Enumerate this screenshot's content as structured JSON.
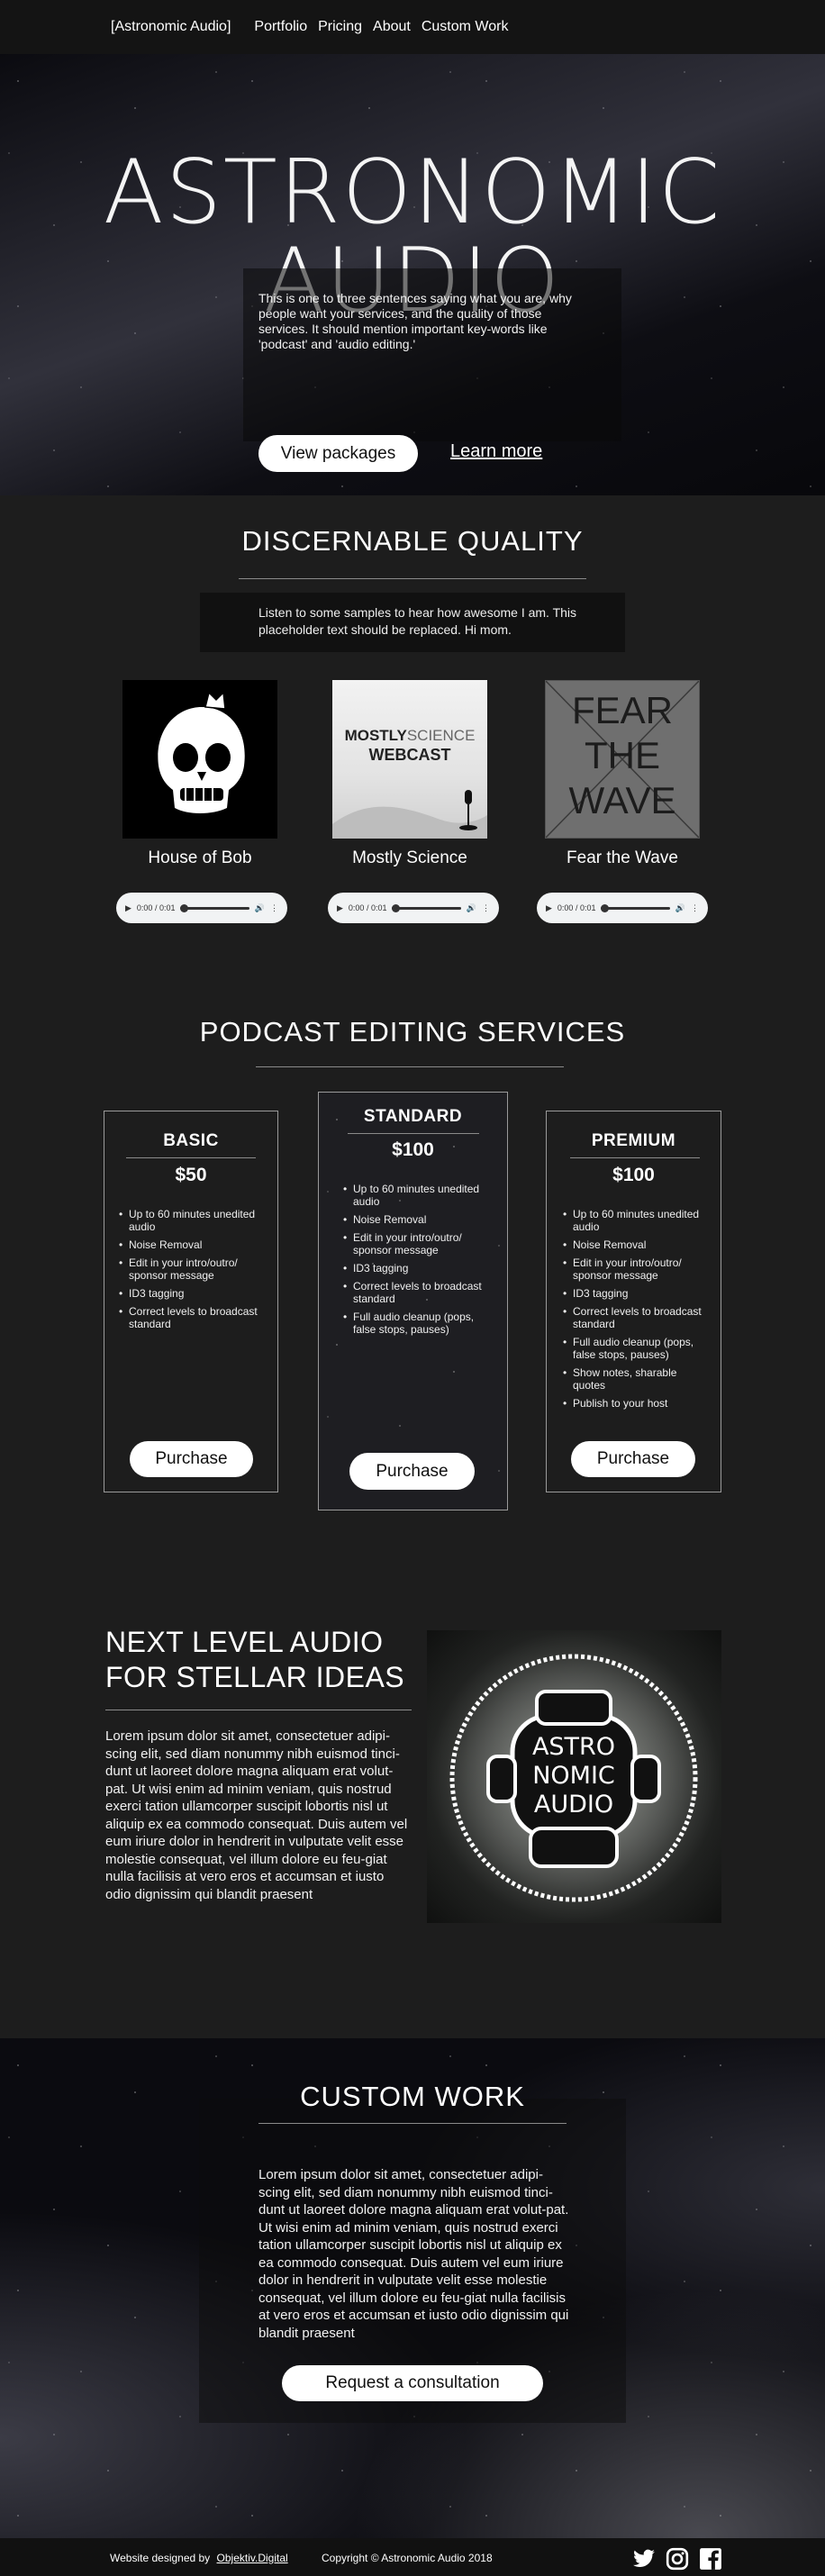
{
  "nav": {
    "brand": "[Astronomic Audio]",
    "items": [
      "Portfolio",
      "Pricing",
      "About",
      "Custom Work"
    ]
  },
  "hero": {
    "title": "ASTRONOMIC AUDIO",
    "text": "This is one to three sentences saying what you are, why people want your services, and the quality of those services. It should mention important key-words like 'podcast' and 'audio editing.'",
    "primary_button": "View packages",
    "secondary_link": "Learn more"
  },
  "quality": {
    "heading": "DISCERNABLE QUALITY",
    "text": "Listen to some samples to hear how awesome I am. This placeholder text should be replaced. Hi mom.",
    "samples": [
      {
        "label": "House of Bob",
        "time": "0:00 / 0:01"
      },
      {
        "label": "Mostly Science",
        "time": "0:00 / 0:01",
        "art_line1_a": "MOSTLY",
        "art_line1_b": "SCIENCE",
        "art_line2": "WEBCAST"
      },
      {
        "label": "Fear the Wave",
        "time": "0:00 / 0:01",
        "art_lines": [
          "FEAR",
          "THE",
          "WAVE"
        ]
      }
    ]
  },
  "services": {
    "heading": "PODCAST EDITING SERVICES",
    "plans": [
      {
        "name": "BASIC",
        "price": "$50",
        "features": [
          "Up to 60 minutes unedited audio",
          "Noise Removal",
          "Edit in your intro/outro/ sponsor message",
          "ID3 tagging",
          "Correct levels to broadcast standard"
        ],
        "button": "Purchase"
      },
      {
        "name": "STANDARD",
        "price": "$100",
        "features": [
          "Up to 60 minutes unedited audio",
          "Noise Removal",
          "Edit in your intro/outro/ sponsor message",
          "ID3 tagging",
          "Correct levels to broadcast standard",
          "Full audio cleanup (pops, false stops, pauses)"
        ],
        "button": "Purchase"
      },
      {
        "name": "PREMIUM",
        "price": "$100",
        "features": [
          "Up to 60 minutes unedited audio",
          "Noise Removal",
          "Edit in your intro/outro/ sponsor message",
          "ID3 tagging",
          "Correct levels to broadcast standard",
          "Full audio cleanup (pops, false stops, pauses)",
          "Show notes, sharable quotes",
          "Publish to your host"
        ],
        "button": "Purchase"
      }
    ]
  },
  "about": {
    "heading_line1": "NEXT LEVEL AUDIO",
    "heading_line2": "FOR STELLAR IDEAS",
    "text": "Lorem ipsum dolor sit amet, consectetuer adipi-scing elit, sed diam nonummy nibh euismod tinci-dunt ut laoreet dolore magna aliquam erat volut-pat. Ut wisi enim ad minim veniam, quis nostrud exerci tation ullamcorper suscipit lobortis nisl ut aliquip ex ea commodo consequat. Duis autem vel eum iriure dolor in hendrerit in vulputate velit esse molestie consequat, vel illum dolore eu feu-giat nulla facilisis at vero eros et accumsan et iusto odio dignissim qui blandit praesent",
    "logo_lines": [
      "ASTRO",
      "NOMIC",
      "AUDIO"
    ]
  },
  "custom": {
    "heading": "CUSTOM WORK",
    "text": "Lorem ipsum dolor sit amet, consectetuer adipi-scing elit, sed diam nonummy nibh euismod tinci-dunt ut laoreet dolore magna aliquam erat volut-pat. Ut wisi enim ad minim veniam, quis nostrud exerci tation ullamcorper suscipit lobortis nisl ut aliquip ex ea commodo consequat. Duis autem vel eum iriure dolor in hendrerit in vulputate velit esse molestie consequat, vel illum dolore eu feu-giat nulla facilisis at vero eros et accumsan et iusto odio dignissim qui blandit praesent",
    "button": "Request a consultation"
  },
  "footer": {
    "designed_prefix": "Website designed by",
    "designed_link": "Objektiv.Digital",
    "copyright": "Copyright © Astronomic Audio 2018",
    "social": [
      "twitter-icon",
      "instagram-icon",
      "facebook-icon"
    ]
  },
  "colors": {
    "page_bg": "#1d1d1d",
    "nav_bg": "#141414",
    "button_bg": "#ffffff",
    "button_text": "#111111"
  }
}
